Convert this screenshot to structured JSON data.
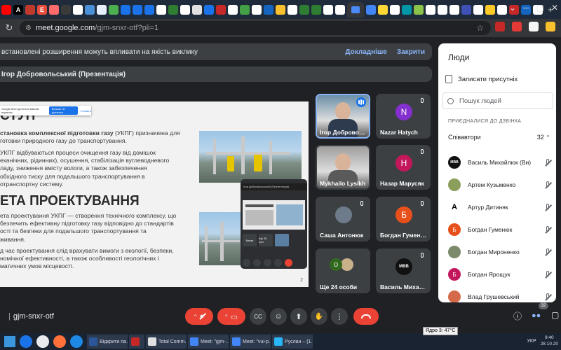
{
  "browser": {
    "tabs_icons": [
      {
        "glyph": "",
        "color": "#ff0000"
      },
      {
        "glyph": "A",
        "color": "#000000"
      },
      {
        "glyph": "",
        "color": "#c0392b"
      },
      {
        "glyph": "E",
        "color": "#e74c3c"
      },
      {
        "glyph": "",
        "color": "#ff6b6b"
      },
      {
        "glyph": "",
        "color": "#3a3a3a"
      },
      {
        "glyph": "",
        "color": "#ffffff"
      },
      {
        "glyph": "",
        "color": "#4a90d9"
      },
      {
        "glyph": "",
        "color": "#e8f0fe"
      },
      {
        "glyph": "",
        "color": "#4caf50"
      },
      {
        "glyph": "",
        "color": "#1a73e8"
      },
      {
        "glyph": "",
        "color": "#1a73e8"
      },
      {
        "glyph": "",
        "color": "#1a73e8"
      },
      {
        "glyph": "",
        "color": "#ffffff"
      },
      {
        "glyph": "",
        "color": "#2e7d32"
      },
      {
        "glyph": "",
        "color": "#ffffff"
      },
      {
        "glyph": "",
        "color": "#e0e0e0"
      },
      {
        "glyph": "",
        "color": "#1a73e8"
      },
      {
        "glyph": "",
        "color": "#c62828"
      },
      {
        "glyph": "",
        "color": "#ffffff"
      },
      {
        "glyph": "",
        "color": "#43a047"
      },
      {
        "glyph": "",
        "color": "#ffffff"
      },
      {
        "glyph": "",
        "color": "#1565c0"
      },
      {
        "glyph": "",
        "color": "#fbc02d"
      },
      {
        "glyph": "",
        "color": "#ffffff"
      },
      {
        "glyph": "",
        "color": "#2e7d32"
      },
      {
        "glyph": "",
        "color": "#2e7d32"
      },
      {
        "glyph": "",
        "color": "#ffffff"
      },
      {
        "glyph": "",
        "color": "#ffffff"
      },
      {
        "glyph": "",
        "color": "#4285f4"
      },
      {
        "glyph": "",
        "color": "#fdd835"
      },
      {
        "glyph": "",
        "color": "#ffffff"
      },
      {
        "glyph": "",
        "color": "#0097a7"
      },
      {
        "glyph": "",
        "color": "#8bc34a"
      },
      {
        "glyph": "",
        "color": "#ffffff"
      },
      {
        "glyph": "",
        "color": "#ffffff"
      },
      {
        "glyph": "",
        "color": "#ffffff"
      },
      {
        "glyph": "",
        "color": "#3f51b5"
      },
      {
        "glyph": "",
        "color": "#ffffff"
      },
      {
        "glyph": "",
        "color": "#ffca28"
      },
      {
        "glyph": "",
        "color": "#ffffff"
      },
      {
        "glyph": "",
        "color": "#c62828"
      },
      {
        "glyph": "",
        "color": "#1565c0"
      },
      {
        "glyph": "",
        "color": "#ffffff"
      }
    ],
    "active_tab_color": "#4a8af4",
    "tab_add": "+",
    "win_controls": [
      "⌄",
      "─",
      "▢",
      "✕"
    ],
    "url_host": "meet.google.com",
    "url_path": "/gjm-snxr-otf?pli=1",
    "ext_colors": [
      "#c62828",
      "#e53935",
      "#f5f5f5",
      "#fbc02d",
      "#4285f4",
      "#9aa0a6",
      "#e8eaed"
    ]
  },
  "meet": {
    "warning_text": "встановлені розширення можуть впливати на якість виклику",
    "warning_more": "Докладніше",
    "warning_close": "Закрити",
    "presenter_label": "Ігор Добровольський (Презентація)",
    "slide": {
      "heading1": "СТУП",
      "para1_bold": "становка комплексної підготовки газу",
      "para1_rest": " (УКПГ) призначена для\nготовки природного газу до транспортування.",
      "para2": "УКПГ відбуваються процеси очищення газу від домішок\nеханічних, рідинних), осушення, стабілізація вуглеводневого\nладу, зниження вмісту вологи, а також забезпечення\nобхідного тиску для подальшого транспортування в\nотранспортну систему.",
      "heading2": "ЕТА ПРОЕКТУВАННЯ",
      "para3": "ета проектування УКПГ — створення технічного комплексу, що\nбезпечить ефективну підготовку газу відповідно до стандартів\nості та безпеки для подальшого транспортування та\nживання.",
      "para4": "д час проектування слід врахувати вимоги з екології, безпеки,\nномічної ефективності, а також особливості геологічних і\nматичних умов місцевості.",
      "page_num": "2",
      "tri": "▲",
      "popup_text": "Google Meet ділиться вашим екраном",
      "popup_btn": "Більше не ділитися",
      "popup_link": "Сховати"
    },
    "mini": {
      "header": "Ігор Добровольський (Презентація)",
      "tiles": [
        {
          "label": "Nazar"
        },
        {
          "label": "Ще 20 чол."
        },
        {
          "label": ""
        }
      ]
    },
    "tiles": [
      {
        "name": "Ігор Доброво…",
        "type": "video",
        "speaking": true,
        "bg": "#6b8fa8"
      },
      {
        "name": "Nazar Hatych",
        "type": "avatar",
        "letter": "N",
        "color": "#8430ce"
      },
      {
        "name": "Mykhailo Lysikh",
        "type": "video",
        "speaking": false,
        "bg": "#9e9e9e"
      },
      {
        "name": "Назар Марусяк",
        "type": "avatar",
        "letter": "Н",
        "color": "#c2185b"
      },
      {
        "name": "Саша Антонюк",
        "type": "photo",
        "color": "#6d7b8a"
      },
      {
        "name": "Богдан Гумен…",
        "type": "avatar",
        "letter": "Б",
        "color": "#e8501b"
      },
      {
        "name": "Ще 24 особи",
        "type": "more",
        "letter": "O",
        "color": "#33691e"
      },
      {
        "name": "Василь Миха…",
        "type": "avatar",
        "letter": "МВВ",
        "color": "#111111"
      }
    ],
    "mic_off_icon": "🎙",
    "meet_code": "gjm-snxr-otf",
    "controls": {
      "caret": "^",
      "mic": "🎤",
      "cam": "📷",
      "cc": "CC",
      "emoji": "☺",
      "present": "⬆",
      "hand": "✋",
      "more": "⋮",
      "hangup": "📞",
      "info": "ⓘ",
      "people": "👥",
      "chat": "💬",
      "people_count": "32"
    }
  },
  "people": {
    "title": "Люди",
    "record_icon": "🗒",
    "record_label": "Записати присутніх",
    "search_icon": "🔍",
    "search_placeholder": "Пошук людей",
    "section_label": "ПРИЄДНАЛИСЯ ДО ДЗВІНКА",
    "group_label": "Співавтори",
    "group_count": "32",
    "list": [
      {
        "name": "Василь Михайлюк (Ви)",
        "letter": "МВВ",
        "color": "#111111"
      },
      {
        "name": "Артем Кузьменко",
        "letter": "",
        "color": "#8c9e5c"
      },
      {
        "name": "Артур Дитиняк",
        "letter": "A",
        "color": "#ffffff"
      },
      {
        "name": "Богдан Гуменюк",
        "letter": "Б",
        "color": "#e8501b"
      },
      {
        "name": "Богдан Мироненко",
        "letter": "",
        "color": "#7a8a6a"
      },
      {
        "name": "Богдан Ярощук",
        "letter": "Б",
        "color": "#c2185b"
      },
      {
        "name": "Влад Грушевський",
        "letter": "",
        "color": "#d46a4a"
      }
    ]
  },
  "taskbar": {
    "icons": [
      "#1a73e8",
      "#e8eaed",
      "#ff7139",
      "#1e88e5"
    ],
    "tasks": [
      {
        "label": "Відкрити па…",
        "color": "#2b579a"
      },
      {
        "label": "",
        "color": "#c62828"
      },
      {
        "label": "Total Comm…",
        "color": "#e0e0e0"
      },
      {
        "label": "Meet: \"gjm-…",
        "color": "#4285f4"
      },
      {
        "label": "Meet: \"vui-p…",
        "color": "#4285f4"
      },
      {
        "label": "Руслан – (1…",
        "color": "#29b6f6"
      }
    ],
    "tooltip": "Ядро 3: 47°C",
    "lang": "УКР",
    "time": "9:40",
    "date": "28.10.20"
  }
}
